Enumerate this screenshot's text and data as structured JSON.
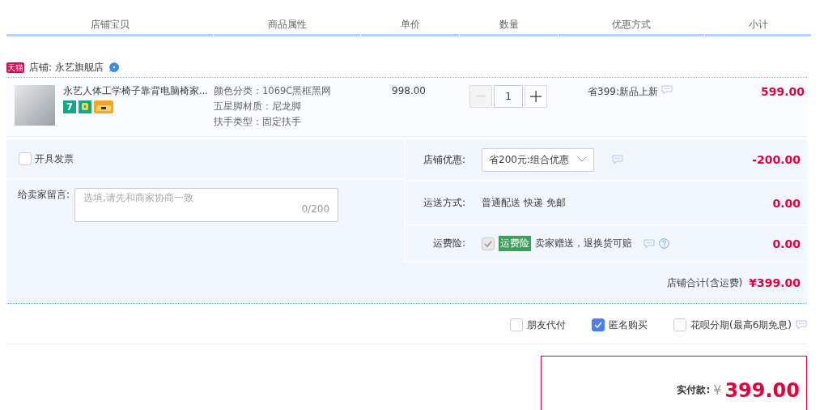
{
  "columns": [
    "店铺宝贝",
    "商品属性",
    "单价",
    "数量",
    "优惠方式",
    "小计"
  ],
  "store": {
    "badge": "天猫",
    "name": "店铺: 永艺旗舰店"
  },
  "item": {
    "title": "永艺人体工学椅子靠背电脑椅家...",
    "service_badges": [
      {
        "kind": "seven_day",
        "label": "7"
      },
      {
        "kind": "guarantee"
      },
      {
        "kind": "card"
      }
    ],
    "attributes": [
      "颜色分类：1069C黑框黑网",
      "五星脚材质：尼龙脚",
      "扶手类型：固定扶手"
    ],
    "price": "998.00",
    "quantity": "1",
    "promotion": "省399:新品上新",
    "subtotal": "599.00"
  },
  "invoice": {
    "label": "开具发票",
    "checked": false
  },
  "message": {
    "label": "给卖家留言:",
    "placeholder": "选填,请先和商家协商一致",
    "counter": "0/200"
  },
  "rows": [
    {
      "kind": "select",
      "label": "店铺优惠:",
      "value": "省200元:组合优惠",
      "amount": "-200.00"
    },
    {
      "kind": "text",
      "label": "运送方式:",
      "value": "普通配送 快递 免邮",
      "amount": "0.00"
    },
    {
      "kind": "insurance",
      "label": "运费险:",
      "tag": "运费险",
      "value": "卖家赠送，退换货可赔",
      "checked": true,
      "amount": "0.00"
    }
  ],
  "store_total": {
    "label": "店铺合计(含运费)",
    "amount": "¥399.00"
  },
  "options": [
    {
      "kind": "plain",
      "label": "朋友代付",
      "checked": false
    },
    {
      "kind": "plain",
      "label": "匿名购买",
      "checked": true
    },
    {
      "kind": "info",
      "label": "花呗分期(最高6期免息)",
      "checked": false
    }
  ],
  "payment": {
    "label": "实付款:",
    "currency": "¥",
    "amount": "399.00"
  }
}
